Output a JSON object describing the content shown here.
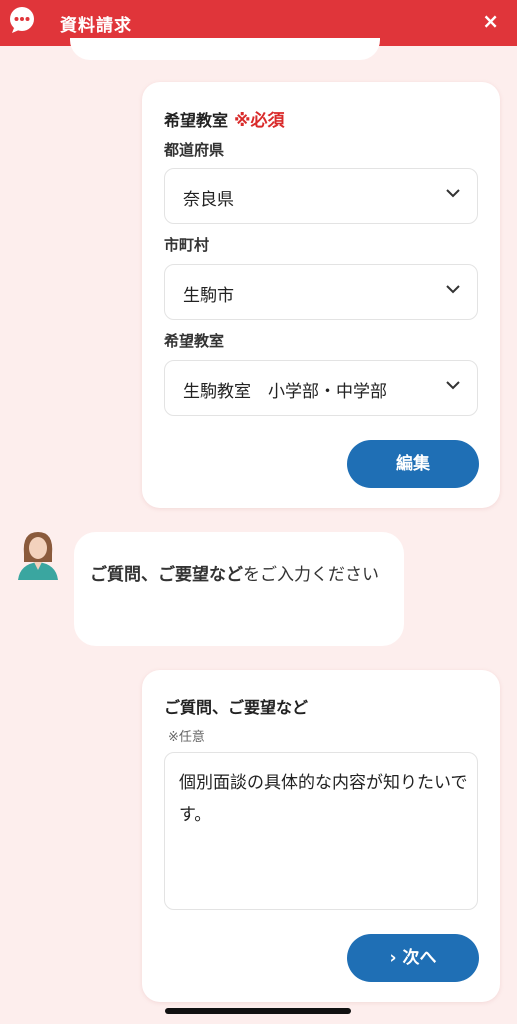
{
  "header": {
    "title": "資料請求",
    "close_label": "×",
    "icon": "chat-bubble-icon",
    "color": "#e0353a"
  },
  "classroom_card": {
    "heading": "希望教室",
    "required": "※必須",
    "prefecture_label": "都道府県",
    "prefecture_value": "奈良県",
    "city_label": "市町村",
    "city_value": "生駒市",
    "school_label": "希望教室",
    "school_value": "生駒教室　小学部・中学部",
    "edit_button": "編集"
  },
  "bot_message": {
    "bold": "ご質問、ご要望など",
    "rest": "をご入力ください"
  },
  "question_card": {
    "heading": "ご質問、ご要望など",
    "optional": "※任意",
    "textarea_value": "個別面談の具体的な内容が知りたいです。",
    "next_button": "› 次へ"
  },
  "colors": {
    "accent": "#1f6fb5",
    "required": "#d92a2a",
    "background": "#fdeeed"
  }
}
